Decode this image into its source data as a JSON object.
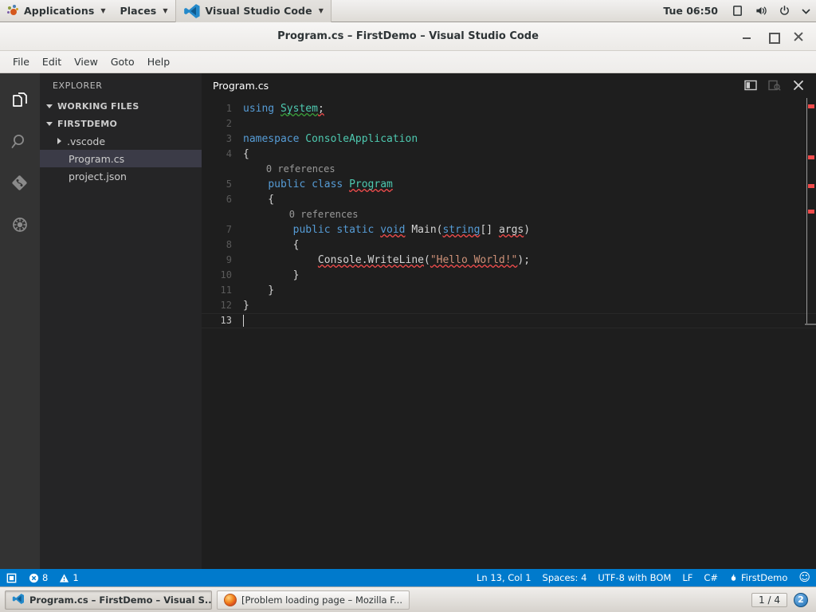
{
  "desktop": {
    "panel": {
      "applications_label": "Applications",
      "places_label": "Places",
      "app_label": "Visual Studio Code",
      "clock": "Tue 06:50",
      "icons": [
        "display-icon",
        "volume-icon",
        "power-icon",
        "chevron-down-icon"
      ]
    },
    "taskbar": {
      "items": [
        {
          "title": "Program.cs – FirstDemo – Visual S...",
          "icon": "vscode-icon",
          "active": true
        },
        {
          "title": "[Problem loading page – Mozilla F...",
          "icon": "firefox-icon",
          "active": false
        }
      ],
      "workspace_pager": "1 / 4",
      "workspace_badge": "2"
    }
  },
  "window": {
    "title": "Program.cs – FirstDemo – Visual Studio Code",
    "controls": {
      "minimize": "–",
      "maximize": "□",
      "close": "✕"
    }
  },
  "menubar": {
    "items": [
      {
        "label": "File"
      },
      {
        "label": "Edit"
      },
      {
        "label": "View"
      },
      {
        "label": "Goto"
      },
      {
        "label": "Help"
      }
    ]
  },
  "activitybar": {
    "items": [
      {
        "name": "explorer",
        "icon": "files-icon",
        "active": true
      },
      {
        "name": "search",
        "icon": "search-icon",
        "active": false
      },
      {
        "name": "source-control",
        "icon": "git-icon",
        "active": false
      },
      {
        "name": "debug",
        "icon": "debug-icon",
        "active": false
      }
    ]
  },
  "sidebar": {
    "title": "EXPLORER",
    "sections": [
      {
        "label": "WORKING FILES",
        "expanded": true
      },
      {
        "label": "FIRSTDEMO",
        "expanded": true
      }
    ],
    "files": [
      {
        "label": ".vscode",
        "type": "folder",
        "expanded": false,
        "selected": false
      },
      {
        "label": "Program.cs",
        "type": "file",
        "selected": true
      },
      {
        "label": "project.json",
        "type": "file",
        "selected": false
      }
    ]
  },
  "editor": {
    "tab_label": "Program.cs",
    "actions": [
      {
        "name": "split-editor",
        "icon": "split-editor-icon"
      },
      {
        "name": "open-preview",
        "icon": "preview-icon"
      },
      {
        "name": "close-editor",
        "icon": "close-icon"
      }
    ],
    "lines": [
      {
        "num": "1",
        "tokens": [
          {
            "t": "using ",
            "c": "kw"
          },
          {
            "t": "System",
            "c": "typ warnu"
          },
          {
            "t": ";",
            "c": "pln err"
          }
        ]
      },
      {
        "num": "2",
        "tokens": []
      },
      {
        "num": "3",
        "tokens": [
          {
            "t": "namespace ",
            "c": "kw"
          },
          {
            "t": "ConsoleApplication",
            "c": "typ"
          }
        ]
      },
      {
        "num": "4",
        "tokens": [
          {
            "t": "{",
            "c": "pln"
          }
        ]
      },
      {
        "num": "",
        "tokens": [
          {
            "t": "    0 references",
            "c": "lens"
          }
        ]
      },
      {
        "num": "5",
        "tokens": [
          {
            "t": "    ",
            "c": "pln"
          },
          {
            "t": "public class ",
            "c": "kw"
          },
          {
            "t": "Program",
            "c": "typ err"
          }
        ]
      },
      {
        "num": "6",
        "tokens": [
          {
            "t": "    {",
            "c": "pln"
          }
        ]
      },
      {
        "num": "",
        "tokens": [
          {
            "t": "        0 references",
            "c": "lens"
          }
        ]
      },
      {
        "num": "7",
        "tokens": [
          {
            "t": "        ",
            "c": "pln"
          },
          {
            "t": "public static ",
            "c": "kw"
          },
          {
            "t": "void",
            "c": "kw err"
          },
          {
            "t": " Main(",
            "c": "pln"
          },
          {
            "t": "string",
            "c": "kw err"
          },
          {
            "t": "[] ",
            "c": "pln"
          },
          {
            "t": "args",
            "c": "pln err"
          },
          {
            "t": ")",
            "c": "pln"
          }
        ]
      },
      {
        "num": "8",
        "tokens": [
          {
            "t": "        {",
            "c": "pln"
          }
        ]
      },
      {
        "num": "9",
        "tokens": [
          {
            "t": "            ",
            "c": "pln"
          },
          {
            "t": "Console.WriteLine",
            "c": "pln err"
          },
          {
            "t": "(",
            "c": "pln"
          },
          {
            "t": "\"Hello World!\"",
            "c": "str err"
          },
          {
            "t": ");",
            "c": "pln"
          }
        ]
      },
      {
        "num": "10",
        "tokens": [
          {
            "t": "        }",
            "c": "pln"
          }
        ]
      },
      {
        "num": "11",
        "tokens": [
          {
            "t": "    }",
            "c": "pln"
          }
        ]
      },
      {
        "num": "12",
        "tokens": [
          {
            "t": "}",
            "c": "pln"
          }
        ]
      },
      {
        "num": "13",
        "tokens": [],
        "current": true,
        "caret": true
      }
    ]
  },
  "statusbar": {
    "left": [
      {
        "name": "remote-icon",
        "label": ""
      },
      {
        "name": "errors",
        "icon": "error-icon",
        "label": "8"
      },
      {
        "name": "warnings",
        "icon": "warning-icon",
        "label": "1"
      }
    ],
    "right": [
      {
        "name": "cursor-position",
        "label": "Ln 13, Col 1"
      },
      {
        "name": "indentation",
        "label": "Spaces: 4"
      },
      {
        "name": "encoding",
        "label": "UTF-8 with BOM"
      },
      {
        "name": "eol",
        "label": "LF"
      },
      {
        "name": "language-mode",
        "label": "C#"
      },
      {
        "name": "project",
        "label": "FirstDemo",
        "icon": "flame-icon"
      },
      {
        "name": "feedback",
        "label": "☺"
      }
    ]
  },
  "colors": {
    "accent": "#007acc",
    "editor_bg": "#1e1e1e",
    "sidebar_bg": "#252526",
    "activitybar_bg": "#333333",
    "keyword": "#569cd6",
    "type": "#4ec9b0",
    "string": "#ce9178",
    "error": "#f14c4c"
  }
}
